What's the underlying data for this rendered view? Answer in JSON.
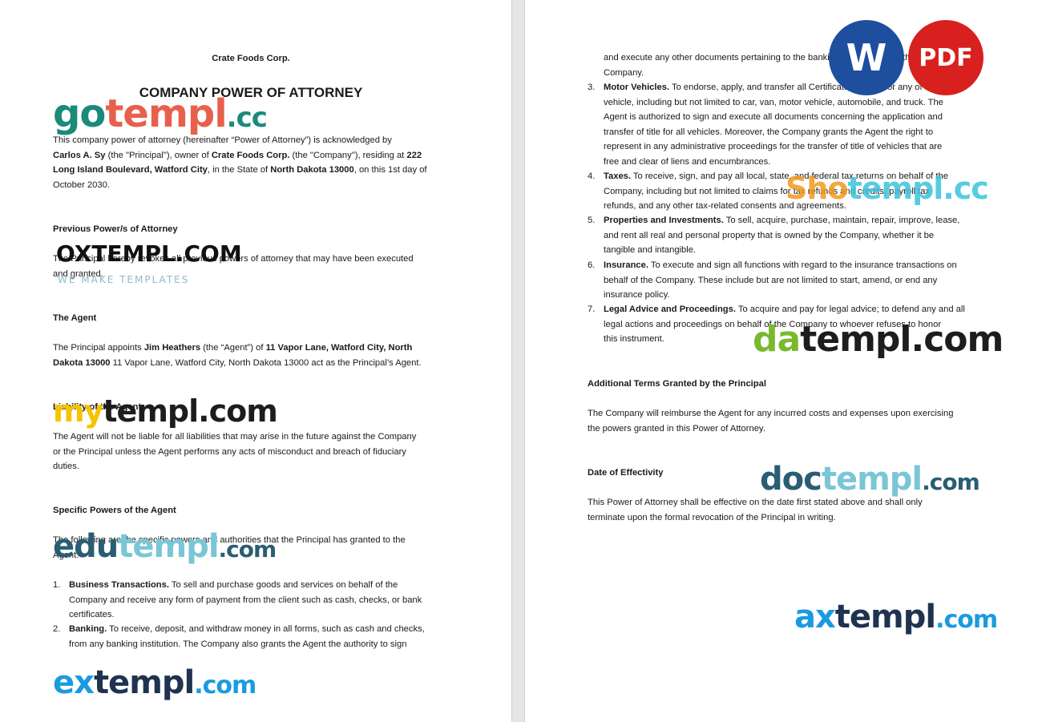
{
  "left": {
    "company_header": "Crate Foods Corp.",
    "doc_title": "COMPANY POWER OF ATTORNEY",
    "intro": [
      [
        {
          "t": "This company power of attorney (hereinafter “Power of Attorney”) is acknowledged by"
        }
      ],
      [
        {
          "t": "Carlos A. Sy",
          "b": true
        },
        {
          "t": " (the \"Principal\"), owner of "
        },
        {
          "t": "Crate Foods Corp.",
          "b": true
        },
        {
          "t": " (the \"Company\"), residing at "
        },
        {
          "t": "222",
          "b": true
        }
      ],
      [
        {
          "t": "Long Island Boulevard, Watford City",
          "b": true
        },
        {
          "t": ", in the State of "
        },
        {
          "t": "North Dakota 13000",
          "b": true
        },
        {
          "t": ", on this 1st day of"
        }
      ],
      [
        {
          "t": "October 2030."
        }
      ]
    ],
    "prev_heading": "Previous Power/s of Attorney",
    "prev_text": [
      [
        {
          "t": "The Principal hereby revokes all previous powers of attorney that may have been executed"
        }
      ],
      [
        {
          "t": "and granted."
        }
      ]
    ],
    "agent_heading": "The Agent",
    "agent_text": [
      [
        {
          "t": "The Principal appoints "
        },
        {
          "t": "Jim Heathers",
          "b": true
        },
        {
          "t": " (the “Agent”) of "
        },
        {
          "t": "11 Vapor Lane, Watford City, North",
          "b": true
        }
      ],
      [
        {
          "t": "Dakota 13000",
          "b": true
        },
        {
          "t": " 11 Vapor Lane, Watford City, North Dakota 13000 act as the Principal’s Agent."
        }
      ]
    ],
    "liability_heading": "Liability of the Agent",
    "liability_text": [
      [
        {
          "t": "The Agent will not be liable for all liabilities that may arise in the future against the Company"
        }
      ],
      [
        {
          "t": "or the Principal unless the Agent performs any acts of misconduct and breach of fiduciary"
        }
      ],
      [
        {
          "t": "duties."
        }
      ]
    ],
    "powers_heading": "Specific Powers of the Agent",
    "powers_intro": [
      [
        {
          "t": "The following are the specific powers and authorities that the Principal has granted to the"
        }
      ],
      [
        {
          "t": "Agent:"
        }
      ]
    ],
    "item1_num": "1.",
    "item1": [
      [
        {
          "t": "Business Transactions.",
          "b": true
        },
        {
          "t": " To sell and purchase goods and services on behalf of the"
        }
      ],
      [
        {
          "t": "Company and receive any form of payment from the client such as cash, checks, or bank"
        }
      ],
      [
        {
          "t": "certificates."
        }
      ]
    ],
    "item2_num": "2.",
    "item2": [
      [
        {
          "t": "Banking.",
          "b": true
        },
        {
          "t": " To receive, deposit, and withdraw money in all forms, such as cash and checks,"
        }
      ],
      [
        {
          "t": "from any banking institution. The Company also grants the Agent the authority to sign"
        }
      ]
    ]
  },
  "right": {
    "cont_text": [
      [
        {
          "t": "and execute any other documents pertaining to the banking transactions of the"
        }
      ],
      [
        {
          "t": "Company."
        }
      ]
    ],
    "item3_num": "3.",
    "item3": [
      [
        {
          "t": "Motor Vehicles.",
          "b": true
        },
        {
          "t": " To endorse, apply, and transfer all Certificates of Title for any of the"
        }
      ],
      [
        {
          "t": "vehicle, including but not limited to car, van, motor vehicle, automobile, and truck. The"
        }
      ],
      [
        {
          "t": "Agent is authorized to sign and execute all documents concerning the application and"
        }
      ],
      [
        {
          "t": "transfer of title for all vehicles. Moreover, the Company grants the Agent the right to"
        }
      ],
      [
        {
          "t": "represent in any administrative proceedings for the transfer of title of vehicles that are"
        }
      ],
      [
        {
          "t": "free and clear of liens and encumbrances."
        }
      ]
    ],
    "item4_num": "4.",
    "item4": [
      [
        {
          "t": "Taxes.",
          "b": true
        },
        {
          "t": " To receive, sign, and pay all local, state, and federal tax returns on behalf of the"
        }
      ],
      [
        {
          "t": "Company, including but not limited to claims for tax refunds and credits, payroll tax"
        }
      ],
      [
        {
          "t": "refunds, and any other tax-related consents and agreements."
        }
      ]
    ],
    "item5_num": "5.",
    "item5": [
      [
        {
          "t": "Properties and Investments.",
          "b": true
        },
        {
          "t": " To sell, acquire, purchase, maintain, repair, improve, lease,"
        }
      ],
      [
        {
          "t": "and rent all real and personal property that is owned by the Company, whether it be"
        }
      ],
      [
        {
          "t": "tangible and intangible."
        }
      ]
    ],
    "item6_num": "6.",
    "item6": [
      [
        {
          "t": "Insurance.",
          "b": true
        },
        {
          "t": " To execute and sign all functions with regard to the insurance transactions on"
        }
      ],
      [
        {
          "t": "behalf of the Company. These include but are not limited to start, amend, or end any"
        }
      ],
      [
        {
          "t": "insurance policy."
        }
      ]
    ],
    "item7_num": "7.",
    "item7": [
      [
        {
          "t": "Legal Advice and Proceedings.",
          "b": true
        },
        {
          "t": " To acquire and pay for legal advice; to defend any and all"
        }
      ],
      [
        {
          "t": "legal actions and proceedings on behalf of the Company to whoever refuses to honor"
        }
      ],
      [
        {
          "t": "this instrument."
        }
      ]
    ],
    "additional_heading": "Additional Terms Granted by the Principal",
    "additional_text": [
      [
        {
          "t": "The Company will reimburse the Agent for any incurred costs and expenses upon exercising"
        }
      ],
      [
        {
          "t": "the powers granted in this Power of Attorney."
        }
      ]
    ],
    "effectivity_heading": "Date of Effectivity",
    "effectivity_text": [
      [
        {
          "t": "This Power of Attorney shall be effective on the date first stated above and shall only"
        }
      ],
      [
        {
          "t": "terminate upon the formal revocation of the Principal in writing."
        }
      ]
    ]
  },
  "watermarks": {
    "gotempl": [
      "go",
      "templ",
      ".cc"
    ],
    "oxtempl": "OXTEMPL.COM",
    "oxtempl_sub": "WE MAKE TEMPLATES",
    "mytempl": [
      "my",
      "templ.com"
    ],
    "edutempl": [
      "edu",
      "templ",
      ".com"
    ],
    "extempl": [
      "ex",
      "templ",
      ".com"
    ],
    "shotempl": [
      "Sho",
      "templ.cc"
    ],
    "datempl": [
      "da",
      "templ.com"
    ],
    "doctempl": [
      "doc",
      "templ",
      ".com"
    ],
    "axtempl": [
      "ax",
      "templ",
      ".com"
    ]
  },
  "badges": {
    "word": "W",
    "pdf": "PDF"
  },
  "colors": {
    "word_badge": "#1e4e9e",
    "pdf_badge": "#d8201f",
    "page": "#ffffff",
    "background": "#e6e6e6"
  }
}
